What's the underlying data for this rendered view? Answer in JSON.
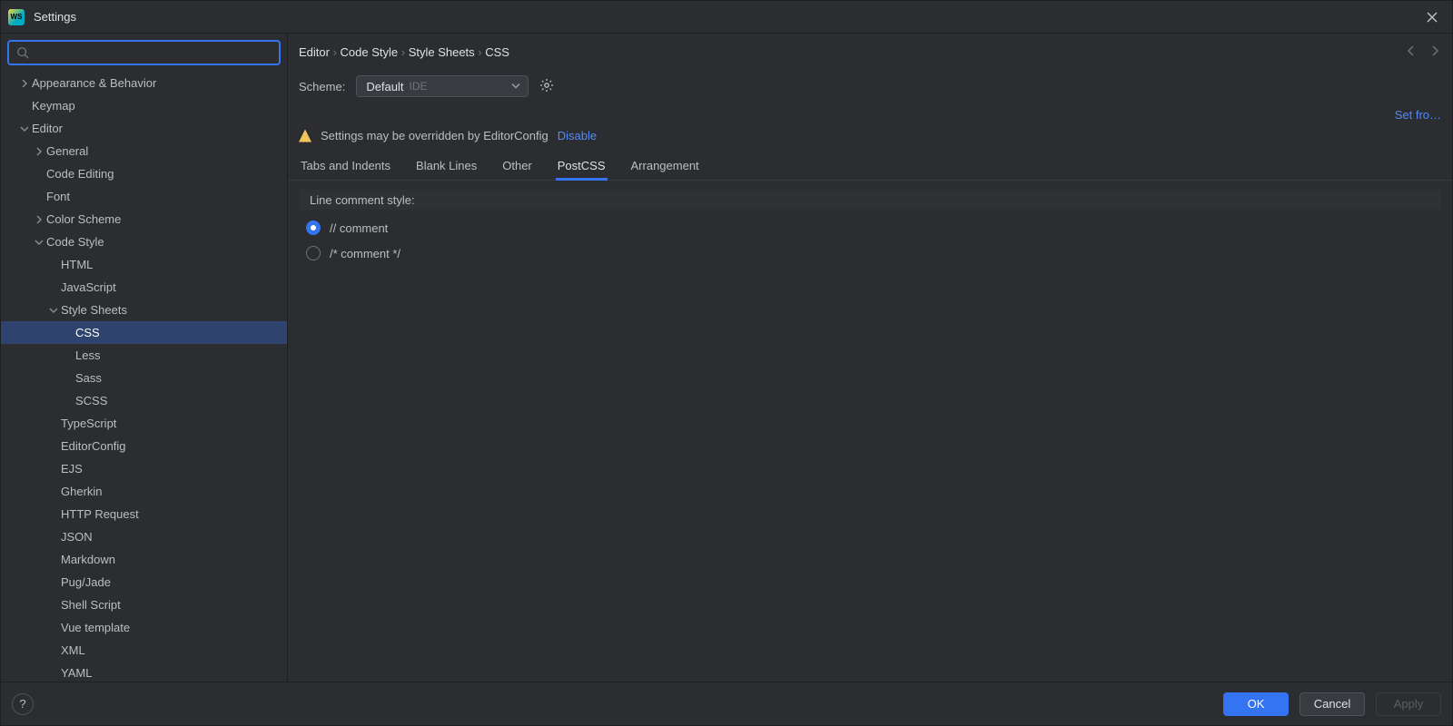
{
  "titlebar": {
    "title": "Settings"
  },
  "search": {
    "placeholder": ""
  },
  "tree": [
    {
      "label": "Appearance & Behavior",
      "depth": 0,
      "chev": "right"
    },
    {
      "label": "Keymap",
      "depth": 0
    },
    {
      "label": "Editor",
      "depth": 0,
      "chev": "down"
    },
    {
      "label": "General",
      "depth": 1,
      "chev": "right"
    },
    {
      "label": "Code Editing",
      "depth": 1
    },
    {
      "label": "Font",
      "depth": 1
    },
    {
      "label": "Color Scheme",
      "depth": 1,
      "chev": "right"
    },
    {
      "label": "Code Style",
      "depth": 1,
      "chev": "down"
    },
    {
      "label": "HTML",
      "depth": 2
    },
    {
      "label": "JavaScript",
      "depth": 2
    },
    {
      "label": "Style Sheets",
      "depth": 2,
      "chev": "down"
    },
    {
      "label": "CSS",
      "depth": 3,
      "selected": true
    },
    {
      "label": "Less",
      "depth": 3
    },
    {
      "label": "Sass",
      "depth": 3
    },
    {
      "label": "SCSS",
      "depth": 3
    },
    {
      "label": "TypeScript",
      "depth": 2
    },
    {
      "label": "EditorConfig",
      "depth": 2
    },
    {
      "label": "EJS",
      "depth": 2
    },
    {
      "label": "Gherkin",
      "depth": 2
    },
    {
      "label": "HTTP Request",
      "depth": 2
    },
    {
      "label": "JSON",
      "depth": 2
    },
    {
      "label": "Markdown",
      "depth": 2
    },
    {
      "label": "Pug/Jade",
      "depth": 2
    },
    {
      "label": "Shell Script",
      "depth": 2
    },
    {
      "label": "Vue template",
      "depth": 2
    },
    {
      "label": "XML",
      "depth": 2
    },
    {
      "label": "YAML",
      "depth": 2
    }
  ],
  "breadcrumb": [
    "Editor",
    "Code Style",
    "Style Sheets",
    "CSS"
  ],
  "scheme": {
    "label": "Scheme:",
    "value": "Default",
    "scope": "IDE"
  },
  "setfrom": "Set fro…",
  "warning": {
    "text": "Settings may be overridden by EditorConfig",
    "link": "Disable"
  },
  "tabs": [
    "Tabs and Indents",
    "Blank Lines",
    "Other",
    "PostCSS",
    "Arrangement"
  ],
  "activeTab": 3,
  "section": {
    "header": "Line comment style:"
  },
  "radios": [
    {
      "label": "// comment",
      "checked": true
    },
    {
      "label": "/* comment */",
      "checked": false
    }
  ],
  "footer": {
    "ok": "OK",
    "cancel": "Cancel",
    "apply": "Apply"
  }
}
